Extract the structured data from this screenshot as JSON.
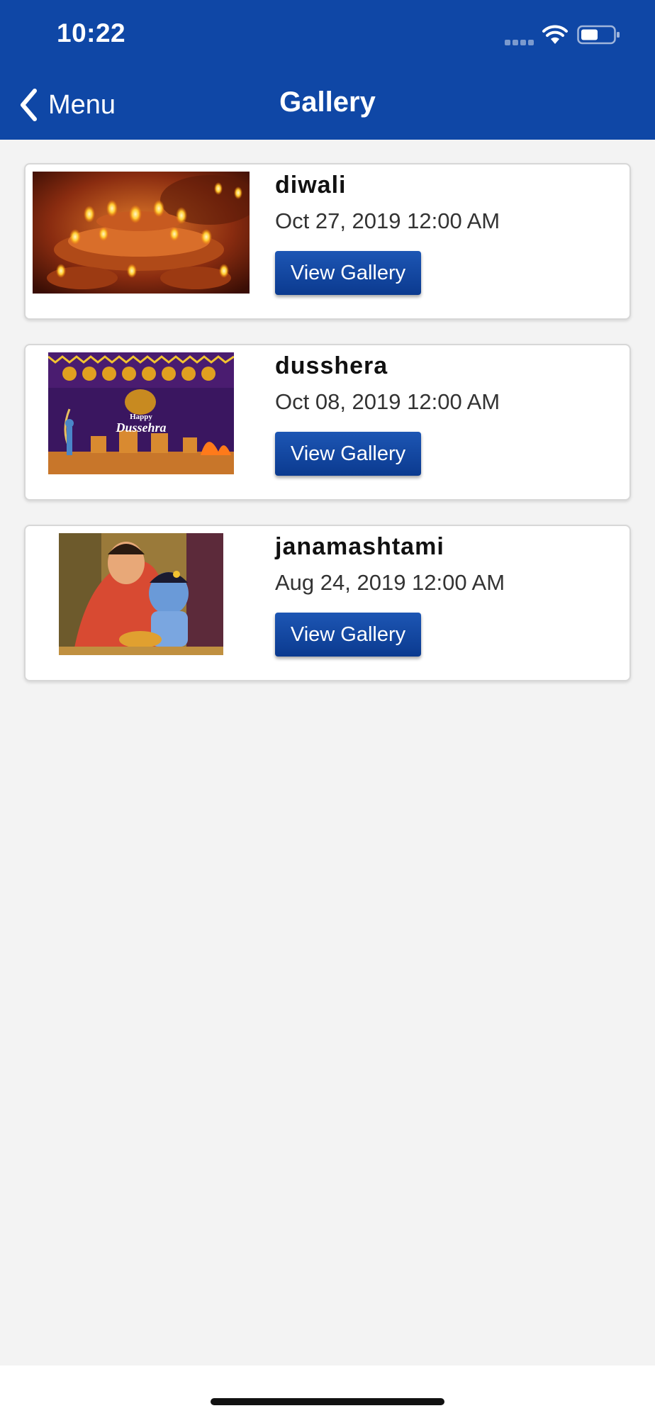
{
  "status_bar": {
    "time": "10:22"
  },
  "nav": {
    "back_label": "Menu",
    "title": "Gallery"
  },
  "items": [
    {
      "title": "diwali",
      "date": "Oct 27, 2019 12:00 AM",
      "button": "View Gallery"
    },
    {
      "title": "dusshera",
      "date": "Oct 08, 2019 12:00 AM",
      "button": "View Gallery"
    },
    {
      "title": "janamashtami",
      "date": "Aug 24, 2019 12:00 AM",
      "button": "View Gallery"
    }
  ],
  "thumb_text": {
    "dussehra_line1": "Happy",
    "dussehra_line2": "Dussehra"
  },
  "colors": {
    "header": "#0f47a6",
    "button": "#0b3a8f",
    "background": "#f3f3f3"
  }
}
